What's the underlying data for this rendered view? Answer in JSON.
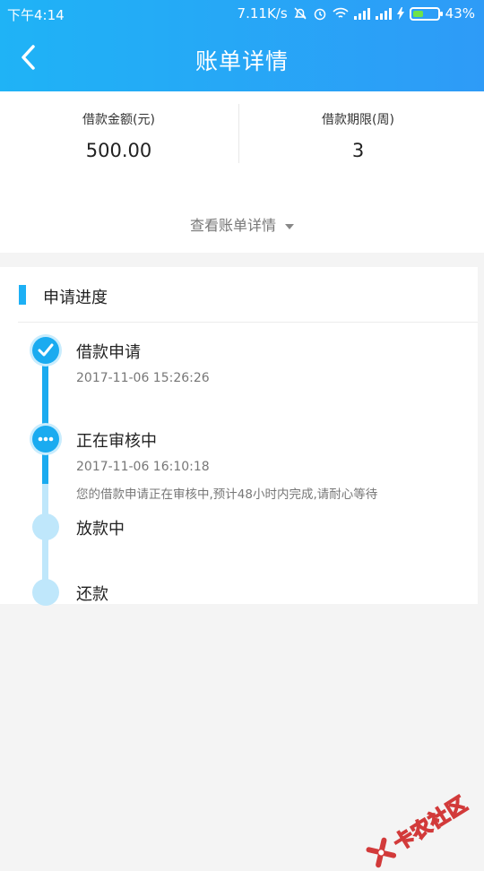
{
  "status": {
    "time": "下午4:14",
    "speed": "7.11K/s",
    "battery_pct": "43%",
    "battery_level": 0.43,
    "battery_color": "#6fe34a"
  },
  "nav": {
    "title": "账单详情",
    "back_icon": "chevron-left-icon"
  },
  "summary": {
    "amount_label": "借款金额(元)",
    "amount_value": "500.00",
    "term_label": "借款期限(周)",
    "term_value": "3",
    "view_detail": "查看账单详情"
  },
  "progress": {
    "section_title": "申请进度",
    "steps": [
      {
        "title": "借款申请",
        "time": "2017-11-06 15:26:26",
        "state": "done",
        "icon": "check-icon"
      },
      {
        "title": "正在审核中",
        "time": "2017-11-06 16:10:18",
        "note": "您的借款申请正在审核中,预计48小时内完成,请耐心等待",
        "state": "current",
        "icon": "more-icon"
      },
      {
        "title": "放款中",
        "state": "pending"
      },
      {
        "title": "还款",
        "state": "pending"
      }
    ]
  },
  "colors": {
    "accent": "#1aabf0",
    "accent_light": "#bfe7fb",
    "header_start": "#1fb3f6",
    "header_end": "#2e9bf7"
  },
  "watermark": {
    "text": "卡农社区"
  }
}
